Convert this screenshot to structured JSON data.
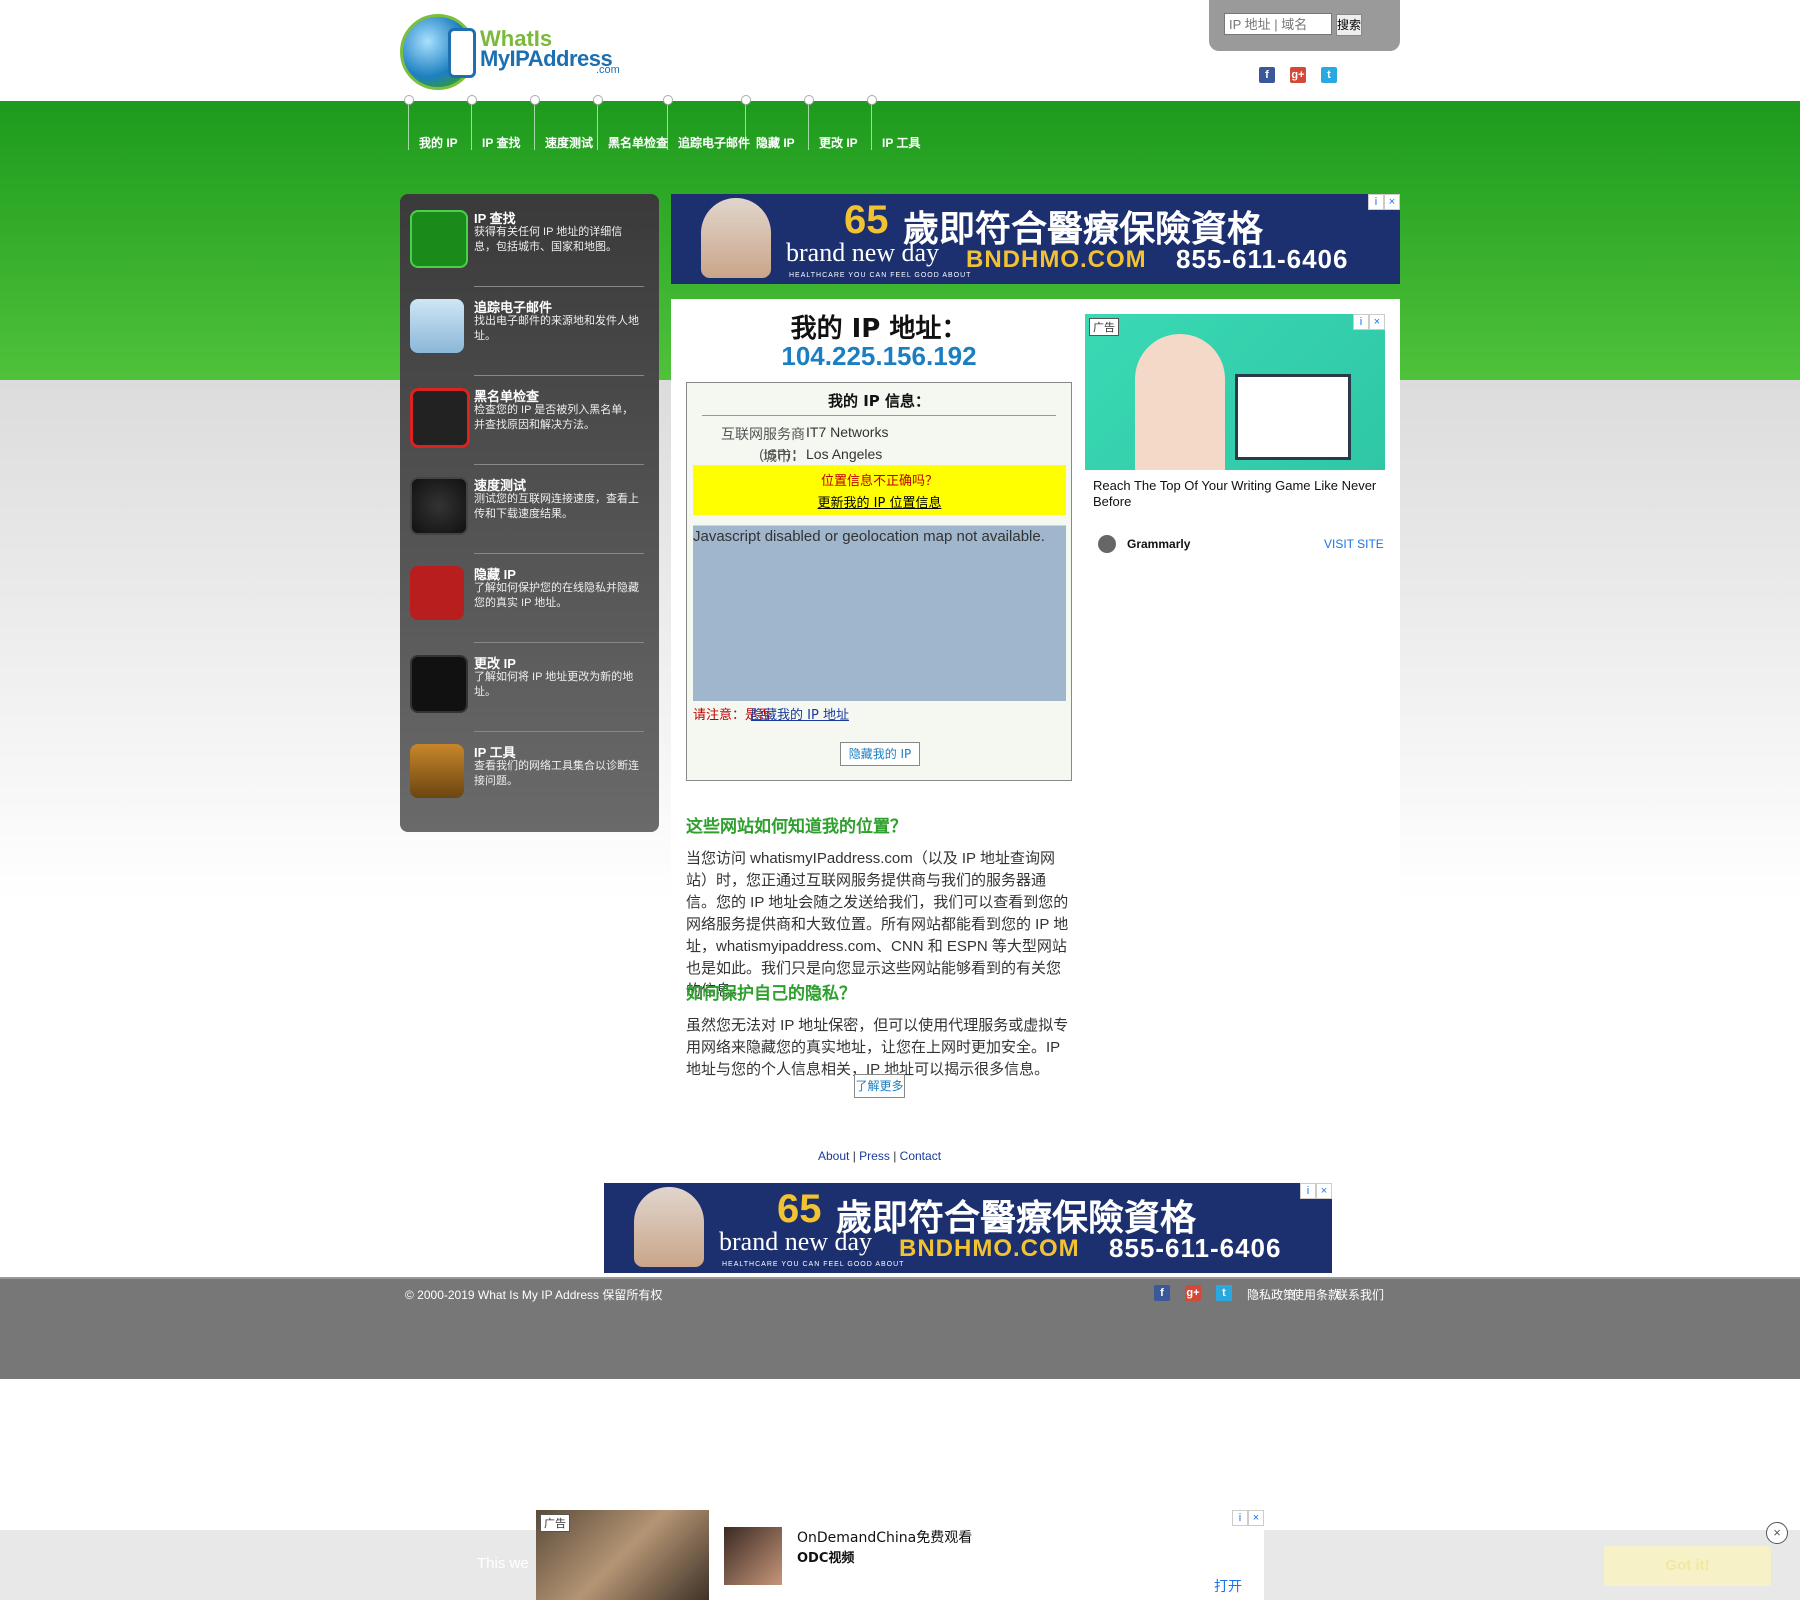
{
  "header": {
    "logo_line1": "WhatIs",
    "logo_line2": "MyIPAddress",
    "logo_line3": ".com",
    "search_placeholder": "IP 地址 | 域名",
    "search_button": "搜索",
    "social": [
      "facebook-icon",
      "googleplus-icon",
      "twitter-icon"
    ]
  },
  "nav": [
    "我的 IP",
    "IP 查找",
    "速度测试",
    "黑名单检查",
    "追踪电子邮件",
    "隐藏 IP",
    "更改 IP",
    "IP 工具"
  ],
  "sidebar": [
    {
      "title": "IP 查找",
      "desc": "获得有关任何 IP 地址的详细信息，包括城市、国家和地图。",
      "icon": "ip-lookup-icon"
    },
    {
      "title": "追踪电子邮件",
      "desc": "找出电子邮件的来源地和发件人地址。",
      "icon": "trace-email-icon"
    },
    {
      "title": "黑名单检查",
      "desc": "检查您的 IP 是否被列入黑名单，并查找原因和解决方法。",
      "icon": "blacklist-icon"
    },
    {
      "title": "速度测试",
      "desc": "测试您的互联网连接速度，查看上传和下载速度结果。",
      "icon": "speedometer-icon"
    },
    {
      "title": "隐藏 IP",
      "desc": "了解如何保护您的在线隐私并隐藏您的真实 IP 地址。",
      "icon": "hide-ip-icon"
    },
    {
      "title": "更改 IP",
      "desc": "了解如何将 IP 地址更改为新的地址。",
      "icon": "change-ip-icon"
    },
    {
      "title": "IP 工具",
      "desc": "查看我们的网络工具集合以诊断连接问题。",
      "icon": "ip-tools-icon"
    }
  ],
  "banner_ad": {
    "number": "65",
    "headline": "歲即符合醫療保險資格",
    "brand": "brand new day",
    "tagline": "HEALTHCARE YOU CAN FEEL GOOD ABOUT",
    "url": "BNDHMO.COM",
    "phone": "855-611-6406"
  },
  "main": {
    "title": "我的 IP 地址：",
    "ip": "104.225.156.192",
    "info_heading": "我的 IP 信息：",
    "isp_label": "互联网服务商 (ISP)：",
    "isp_value": "IT7 Networks",
    "city_label": "城市：",
    "city_value": "Los Angeles",
    "yellow_line1": "位置信息不正确吗？",
    "yellow_line2": "更新我的 IP 位置信息",
    "map_text": "Javascript disabled or geolocation map not available.",
    "warn_text": "请注意：是否",
    "warn_link": "隐藏我的 IP 地址",
    "hide_button": "隐藏我的 IP",
    "section1_title": "这些网站如何知道我的位置？",
    "section1_text": "当您访问 whatismyIPaddress.com（以及 IP 地址查询网站）时，您正通过互联网服务提供商与我们的服务器通信。您的 IP 地址会随之发送给我们，我们可以查看到您的网络服务提供商和大致位置。所有网站都能看到您的 IP 地址，whatismyipaddress.com、CNN 和 ESPN 等大型网站也是如此。我们只是向您显示这些网站能够看到的有关您的信息。",
    "section2_title": "如何保护自己的隐私？",
    "section2_text": "虽然您无法对 IP 地址保密，但可以使用代理服务或虚拟专用网络来隐藏您的真实地址，让您在上网时更加安全。IP 地址与您的个人信息相关，IP 地址可以揭示很多信息。",
    "more_button": "了解更多"
  },
  "side_ad": {
    "tag": "广告",
    "text": "Reach The Top Of Your Writing Game Like Never Before",
    "brand": "Grammarly",
    "visit": "VISIT SITE"
  },
  "footer_links": {
    "about": "About",
    "press": "Press",
    "contact": "Contact",
    "separator": "|"
  },
  "footer": {
    "copyright": "© 2000-2019 What Is My IP Address 保留所有权",
    "menu": [
      "隐私政策",
      "使用条款",
      "联系我们"
    ]
  },
  "cookie": {
    "text": "This we",
    "button": "Got it!"
  },
  "bottom_ad": {
    "tag": "广告",
    "title": "OnDemandChina免费观看",
    "subtitle": "ODC视频",
    "open": "打开"
  },
  "colors": {
    "green_band": "#1d9a1d",
    "ip_blue": "#1a7fc2",
    "section_green": "#2ea02e",
    "warning_red": "#c00000",
    "ad_navy": "#1c2f6e"
  }
}
